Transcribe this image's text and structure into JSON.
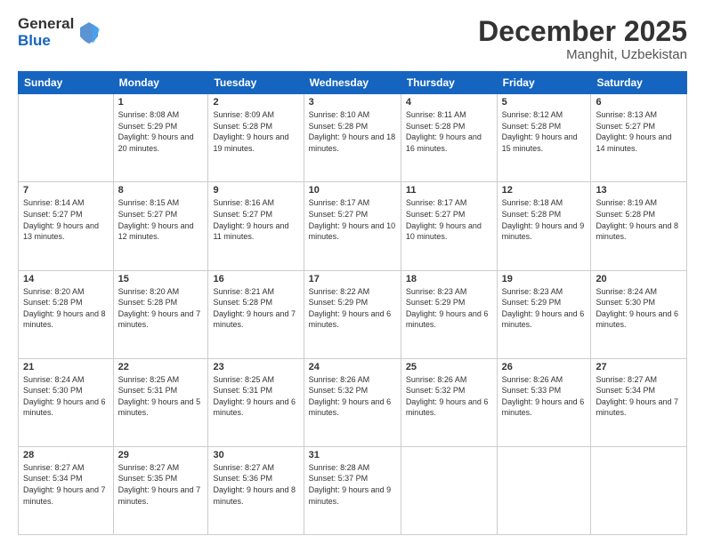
{
  "logo": {
    "text_general": "General",
    "text_blue": "Blue"
  },
  "header": {
    "month": "December 2025",
    "location": "Manghit, Uzbekistan"
  },
  "weekdays": [
    "Sunday",
    "Monday",
    "Tuesday",
    "Wednesday",
    "Thursday",
    "Friday",
    "Saturday"
  ],
  "weeks": [
    [
      {
        "day": "",
        "sunrise": "",
        "sunset": "",
        "daylight": ""
      },
      {
        "day": "1",
        "sunrise": "Sunrise: 8:08 AM",
        "sunset": "Sunset: 5:29 PM",
        "daylight": "Daylight: 9 hours and 20 minutes."
      },
      {
        "day": "2",
        "sunrise": "Sunrise: 8:09 AM",
        "sunset": "Sunset: 5:28 PM",
        "daylight": "Daylight: 9 hours and 19 minutes."
      },
      {
        "day": "3",
        "sunrise": "Sunrise: 8:10 AM",
        "sunset": "Sunset: 5:28 PM",
        "daylight": "Daylight: 9 hours and 18 minutes."
      },
      {
        "day": "4",
        "sunrise": "Sunrise: 8:11 AM",
        "sunset": "Sunset: 5:28 PM",
        "daylight": "Daylight: 9 hours and 16 minutes."
      },
      {
        "day": "5",
        "sunrise": "Sunrise: 8:12 AM",
        "sunset": "Sunset: 5:28 PM",
        "daylight": "Daylight: 9 hours and 15 minutes."
      },
      {
        "day": "6",
        "sunrise": "Sunrise: 8:13 AM",
        "sunset": "Sunset: 5:27 PM",
        "daylight": "Daylight: 9 hours and 14 minutes."
      }
    ],
    [
      {
        "day": "7",
        "sunrise": "Sunrise: 8:14 AM",
        "sunset": "Sunset: 5:27 PM",
        "daylight": "Daylight: 9 hours and 13 minutes."
      },
      {
        "day": "8",
        "sunrise": "Sunrise: 8:15 AM",
        "sunset": "Sunset: 5:27 PM",
        "daylight": "Daylight: 9 hours and 12 minutes."
      },
      {
        "day": "9",
        "sunrise": "Sunrise: 8:16 AM",
        "sunset": "Sunset: 5:27 PM",
        "daylight": "Daylight: 9 hours and 11 minutes."
      },
      {
        "day": "10",
        "sunrise": "Sunrise: 8:17 AM",
        "sunset": "Sunset: 5:27 PM",
        "daylight": "Daylight: 9 hours and 10 minutes."
      },
      {
        "day": "11",
        "sunrise": "Sunrise: 8:17 AM",
        "sunset": "Sunset: 5:27 PM",
        "daylight": "Daylight: 9 hours and 10 minutes."
      },
      {
        "day": "12",
        "sunrise": "Sunrise: 8:18 AM",
        "sunset": "Sunset: 5:28 PM",
        "daylight": "Daylight: 9 hours and 9 minutes."
      },
      {
        "day": "13",
        "sunrise": "Sunrise: 8:19 AM",
        "sunset": "Sunset: 5:28 PM",
        "daylight": "Daylight: 9 hours and 8 minutes."
      }
    ],
    [
      {
        "day": "14",
        "sunrise": "Sunrise: 8:20 AM",
        "sunset": "Sunset: 5:28 PM",
        "daylight": "Daylight: 9 hours and 8 minutes."
      },
      {
        "day": "15",
        "sunrise": "Sunrise: 8:20 AM",
        "sunset": "Sunset: 5:28 PM",
        "daylight": "Daylight: 9 hours and 7 minutes."
      },
      {
        "day": "16",
        "sunrise": "Sunrise: 8:21 AM",
        "sunset": "Sunset: 5:28 PM",
        "daylight": "Daylight: 9 hours and 7 minutes."
      },
      {
        "day": "17",
        "sunrise": "Sunrise: 8:22 AM",
        "sunset": "Sunset: 5:29 PM",
        "daylight": "Daylight: 9 hours and 6 minutes."
      },
      {
        "day": "18",
        "sunrise": "Sunrise: 8:23 AM",
        "sunset": "Sunset: 5:29 PM",
        "daylight": "Daylight: 9 hours and 6 minutes."
      },
      {
        "day": "19",
        "sunrise": "Sunrise: 8:23 AM",
        "sunset": "Sunset: 5:29 PM",
        "daylight": "Daylight: 9 hours and 6 minutes."
      },
      {
        "day": "20",
        "sunrise": "Sunrise: 8:24 AM",
        "sunset": "Sunset: 5:30 PM",
        "daylight": "Daylight: 9 hours and 6 minutes."
      }
    ],
    [
      {
        "day": "21",
        "sunrise": "Sunrise: 8:24 AM",
        "sunset": "Sunset: 5:30 PM",
        "daylight": "Daylight: 9 hours and 6 minutes."
      },
      {
        "day": "22",
        "sunrise": "Sunrise: 8:25 AM",
        "sunset": "Sunset: 5:31 PM",
        "daylight": "Daylight: 9 hours and 5 minutes."
      },
      {
        "day": "23",
        "sunrise": "Sunrise: 8:25 AM",
        "sunset": "Sunset: 5:31 PM",
        "daylight": "Daylight: 9 hours and 6 minutes."
      },
      {
        "day": "24",
        "sunrise": "Sunrise: 8:26 AM",
        "sunset": "Sunset: 5:32 PM",
        "daylight": "Daylight: 9 hours and 6 minutes."
      },
      {
        "day": "25",
        "sunrise": "Sunrise: 8:26 AM",
        "sunset": "Sunset: 5:32 PM",
        "daylight": "Daylight: 9 hours and 6 minutes."
      },
      {
        "day": "26",
        "sunrise": "Sunrise: 8:26 AM",
        "sunset": "Sunset: 5:33 PM",
        "daylight": "Daylight: 9 hours and 6 minutes."
      },
      {
        "day": "27",
        "sunrise": "Sunrise: 8:27 AM",
        "sunset": "Sunset: 5:34 PM",
        "daylight": "Daylight: 9 hours and 7 minutes."
      }
    ],
    [
      {
        "day": "28",
        "sunrise": "Sunrise: 8:27 AM",
        "sunset": "Sunset: 5:34 PM",
        "daylight": "Daylight: 9 hours and 7 minutes."
      },
      {
        "day": "29",
        "sunrise": "Sunrise: 8:27 AM",
        "sunset": "Sunset: 5:35 PM",
        "daylight": "Daylight: 9 hours and 7 minutes."
      },
      {
        "day": "30",
        "sunrise": "Sunrise: 8:27 AM",
        "sunset": "Sunset: 5:36 PM",
        "daylight": "Daylight: 9 hours and 8 minutes."
      },
      {
        "day": "31",
        "sunrise": "Sunrise: 8:28 AM",
        "sunset": "Sunset: 5:37 PM",
        "daylight": "Daylight: 9 hours and 9 minutes."
      },
      {
        "day": "",
        "sunrise": "",
        "sunset": "",
        "daylight": ""
      },
      {
        "day": "",
        "sunrise": "",
        "sunset": "",
        "daylight": ""
      },
      {
        "day": "",
        "sunrise": "",
        "sunset": "",
        "daylight": ""
      }
    ]
  ]
}
